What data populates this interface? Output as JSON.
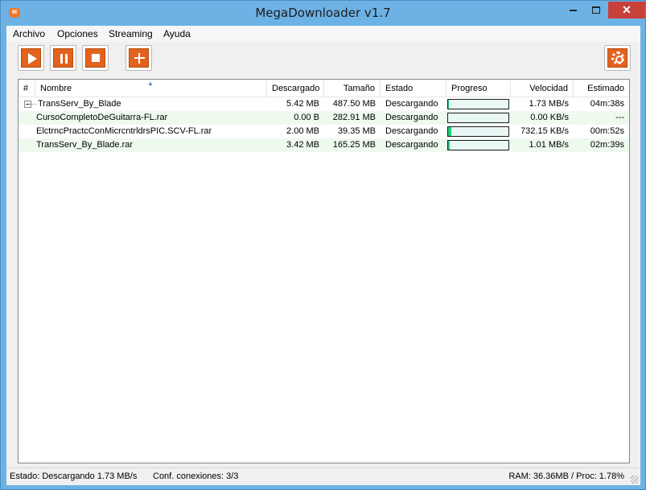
{
  "window": {
    "title": "MegaDownloader v1.7",
    "icon": "megadownloader-logo-icon",
    "icon_text": "M",
    "close_glyph": "✕"
  },
  "menu": [
    "Archivo",
    "Opciones",
    "Streaming",
    "Ayuda"
  ],
  "toolbar": {
    "buttons": [
      {
        "name": "play",
        "icon": "play-icon"
      },
      {
        "name": "pause",
        "icon": "pause-icon"
      },
      {
        "name": "stop",
        "icon": "stop-icon"
      },
      {
        "name": "add",
        "icon": "plus-icon"
      },
      {
        "name": "settings",
        "icon": "gear-icon"
      }
    ],
    "accent_color": "#e2631d"
  },
  "list": {
    "columns": [
      "#",
      "Nombre",
      "Descargado",
      "Tamaño",
      "Estado",
      "Progreso",
      "Velocidad",
      "Estimado"
    ],
    "sorted_by": "Nombre",
    "rows": [
      {
        "level": 0,
        "expanded": true,
        "nombre": "TransServ_By_Blade",
        "descargado": "5.42 MB",
        "tamano": "487.50 MB",
        "estado": "Descargando",
        "progreso": 0.011,
        "velocidad": "1.73 MB/s",
        "estimado": "04m:38s"
      },
      {
        "level": 1,
        "nombre": "CursoCompletoDeGuitarra-FL.rar",
        "descargado": "0.00 B",
        "tamano": "282.91 MB",
        "estado": "Descargando",
        "progreso": 0.0,
        "velocidad": "0.00 KB/s",
        "estimado": "---"
      },
      {
        "level": 1,
        "nombre": "ElctrncPractcConMicrcntrldrsPIC.SCV-FL.rar",
        "descargado": "2.00 MB",
        "tamano": "39.35 MB",
        "estado": "Descargando",
        "progreso": 0.051,
        "velocidad": "732.15 KB/s",
        "estimado": "00m:52s"
      },
      {
        "level": 1,
        "nombre": "TransServ_By_Blade.rar",
        "descargado": "3.42 MB",
        "tamano": "165.25 MB",
        "estado": "Descargando",
        "progreso": 0.021,
        "velocidad": "1.01 MB/s",
        "estimado": "02m:39s"
      }
    ],
    "progress_color": "#1fcf7a"
  },
  "status": {
    "estado": "Estado: Descargando 1.73 MB/s",
    "conexiones": "Conf. conexiones: 3/3",
    "recursos": "RAM: 36.36MB / Proc: 1.78%"
  }
}
